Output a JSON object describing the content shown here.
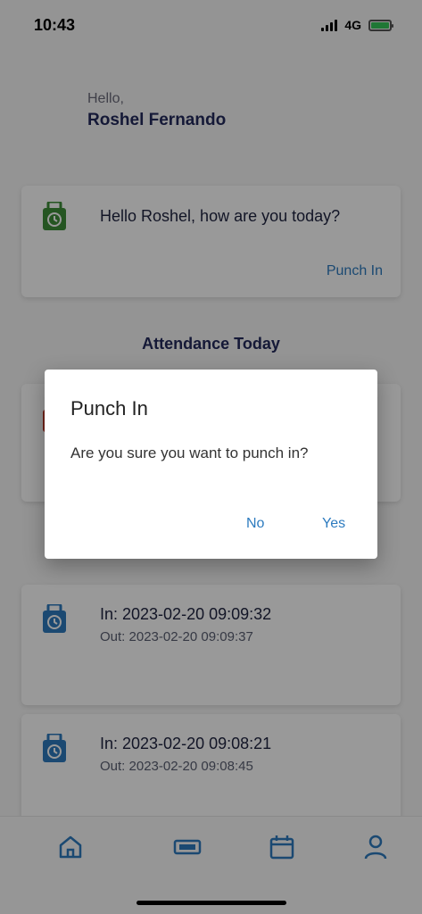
{
  "status_bar": {
    "time": "10:43",
    "network": "4G"
  },
  "greeting": {
    "hello": "Hello,",
    "name": "Roshel Fernando"
  },
  "welcome_card": {
    "message": "Hello Roshel, how are you today?",
    "action_label": "Punch In"
  },
  "attendance": {
    "title": "Attendance Today",
    "records": [
      {
        "in": "In: 2023-02-20 09:09:32",
        "out": "Out: 2023-02-20 09:09:37"
      },
      {
        "in": "In: 2023-02-20 09:08:21",
        "out": "Out: 2023-02-20 09:08:45"
      }
    ]
  },
  "dialog": {
    "title": "Punch In",
    "message": "Are you sure you want to punch in?",
    "no_label": "No",
    "yes_label": "Yes"
  },
  "nav": {
    "items": [
      "home-icon",
      "time-clock-icon",
      "calendar-icon",
      "profile-icon"
    ]
  },
  "colors": {
    "accent": "#2d7bbf",
    "navy": "#232a5c",
    "green": "#3f8e3a",
    "red": "#c0392b"
  }
}
